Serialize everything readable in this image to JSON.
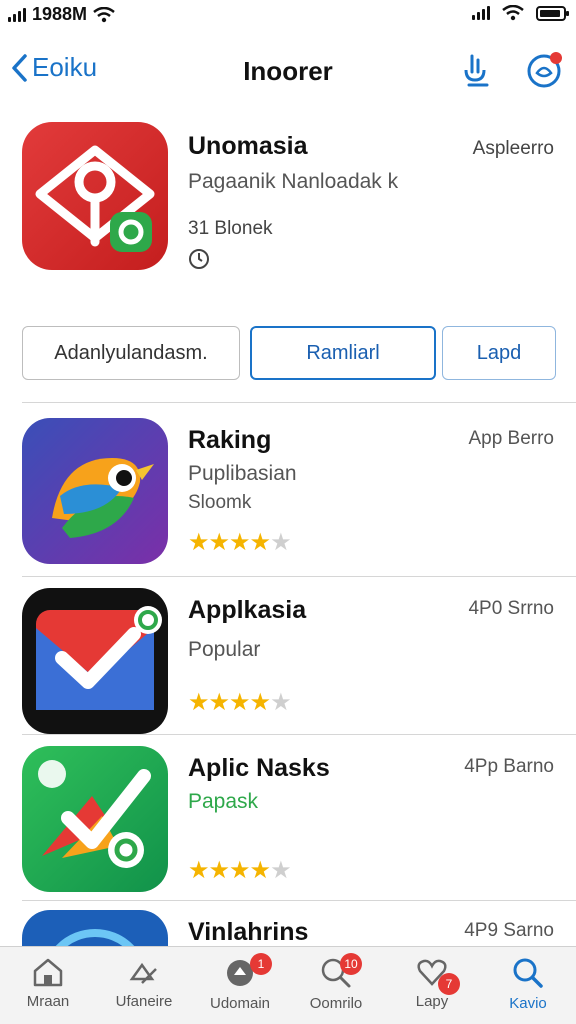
{
  "status_bar": {
    "time": "1988M"
  },
  "nav": {
    "back_label": "Eoiku",
    "title": "Inoorer"
  },
  "featured": {
    "name": "Unomasia",
    "subtitle": "Pagaanik Nanloadak k",
    "size": "31 Blonek",
    "store": "Aspleerro"
  },
  "buttons": {
    "left": "Adanlyulandasm.",
    "center": "Ramliarl",
    "right": "Lapd"
  },
  "apps": [
    {
      "name": "Raking",
      "subtitle": "Puplibasian",
      "subtitle2": "Sloomk",
      "store": "App Berro",
      "rating": 4,
      "max": 5
    },
    {
      "name": "Applkasia",
      "subtitle": "Popular",
      "subtitle2": "",
      "store": "4P0 Srrno",
      "rating": 4,
      "max": 5
    },
    {
      "name": "Aplic Nasks",
      "subtitle": "Papask",
      "subtitle2": "",
      "store": "4Pp Barno",
      "rating": 4,
      "max": 5
    },
    {
      "name": "Vinlahrins",
      "subtitle": "",
      "subtitle2": "",
      "store": "4P9 Sarno"
    }
  ],
  "tabs": [
    {
      "label": "Mraan",
      "icon": "home-icon",
      "badge": ""
    },
    {
      "label": "Ufaneire",
      "icon": "category-icon",
      "badge": ""
    },
    {
      "label": "Udomain",
      "icon": "games-icon",
      "badge": "1"
    },
    {
      "label": "Oomrilo",
      "icon": "search-icon",
      "badge": "10"
    },
    {
      "label": "Lapy",
      "icon": "heart-icon",
      "badge": "7"
    },
    {
      "label": "Kavio",
      "icon": "search-icon",
      "badge": ""
    }
  ],
  "colors": {
    "accent": "#1a73c8",
    "star": "#f5b400",
    "badge": "#e53935"
  }
}
